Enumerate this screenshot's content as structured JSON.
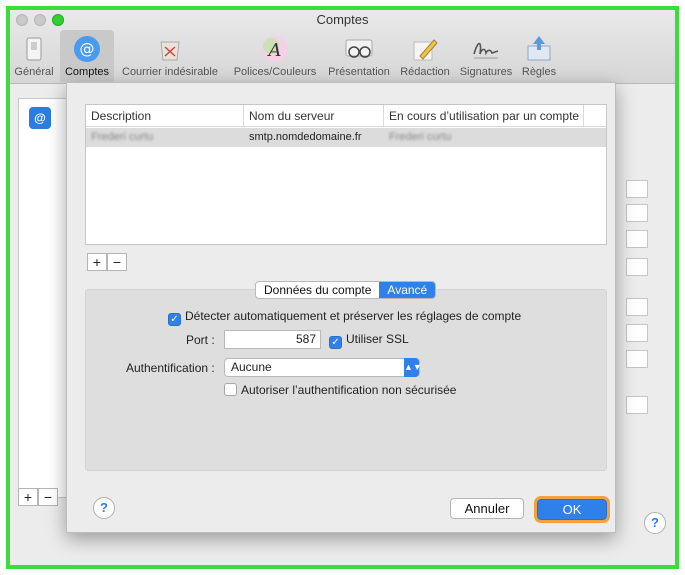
{
  "window": {
    "title": "Comptes"
  },
  "toolbar": {
    "items": [
      {
        "label": "Général",
        "icon": "general-switch-icon"
      },
      {
        "label": "Comptes",
        "icon": "at-sign-icon",
        "selected": true
      },
      {
        "label": "Courrier indésirable",
        "icon": "junk-mail-icon"
      },
      {
        "label": "Polices/Couleurs",
        "icon": "font-colors-icon"
      },
      {
        "label": "Présentation",
        "icon": "glasses-icon"
      },
      {
        "label": "Rédaction",
        "icon": "pencil-icon"
      },
      {
        "label": "Signatures",
        "icon": "signature-icon"
      },
      {
        "label": "Règles",
        "icon": "rules-envelope-icon"
      }
    ]
  },
  "background": {
    "account_icon": "@",
    "add_label": "+",
    "remove_label": "−",
    "help_label": "?"
  },
  "sheet": {
    "table": {
      "columns": [
        "Description",
        "Nom du serveur",
        "En cours d’utilisation par un compte"
      ],
      "rows": [
        [
          "Frederi curtu",
          "smtp.nomdedomaine.fr",
          "Frederi curtu"
        ]
      ]
    },
    "add_label": "+",
    "remove_label": "−",
    "tabs": {
      "account_data": "Données du compte",
      "advanced": "Avancé",
      "selected": "advanced"
    },
    "advanced": {
      "auto_detect_label": "Détecter automatiquement et préserver les réglages de compte",
      "auto_detect_checked": true,
      "port_label": "Port :",
      "port_value": "587",
      "ssl_label": "Utiliser SSL",
      "ssl_checked": true,
      "auth_label": "Authentification :",
      "auth_value": "Aucune",
      "insecure_label": "Autoriser l’authentification non sécurisée",
      "insecure_checked": false
    },
    "help_label": "?",
    "cancel_label": "Annuler",
    "ok_label": "OK"
  },
  "colors": {
    "accent": "#2f80e8",
    "frame_highlight": "#3bdc3b",
    "ok_focus": "#f3a23a"
  }
}
